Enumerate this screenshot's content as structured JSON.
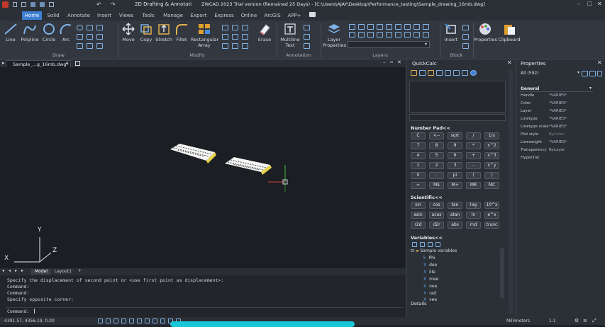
{
  "titlebar": {
    "workspace": "2D Drafting & Annotati",
    "title": "ZWCAD 2023 Trial version (Remained 25 Days) - [C:\\Users\\AJAY\\Desktop\\Performance_testing\\Sample_drawing_16mb.dwg]"
  },
  "tabs": [
    "Home",
    "Solid",
    "Annotate",
    "Insert",
    "Views",
    "Tools",
    "Manage",
    "Export",
    "Express",
    "Online",
    "ArcGIS",
    "APP+"
  ],
  "ribbon": {
    "tools": {
      "line": "Line",
      "polyline": "Polyline",
      "circle": "Circle",
      "arc": "Arc",
      "move": "Move",
      "copy": "Copy",
      "stretch": "Stretch",
      "fillet": "Fillet",
      "rect_array": "Rectangular",
      "rect_array2": "Array",
      "erase": "Erase",
      "mtext": "Multiline",
      "mtext2": "Text",
      "layer_props": "Layer",
      "layer_props2": "Properties",
      "insert": "Insert",
      "properties": "Properties",
      "clipboard": "Clipboard"
    },
    "groups": {
      "draw": "Draw",
      "modify": "Modify",
      "annotation": "Annotation",
      "layers": "Layers",
      "block": "Block"
    }
  },
  "doc_tab": "Sample_...g_16mb.dwg*",
  "layout_tabs": [
    "Model",
    "Layout1"
  ],
  "axes": {
    "x": "X",
    "y": "Y",
    "z": "Z"
  },
  "command": {
    "history": [
      "Specify the displacement of second point or <use first point as displacement>:",
      "Command:",
      "Command:",
      "Specify opposite corner:"
    ],
    "prompt": "Command:"
  },
  "status": {
    "coords": "-4391.57, 4356.19, 0.00",
    "units": "Millimeters",
    "scale": "1:1"
  },
  "quickcalc": {
    "title": "QuickCalc",
    "numberpad_label": "Number Pad<<",
    "numberpad": [
      [
        "C",
        "<--",
        "sqrt",
        "/",
        "1/x"
      ],
      [
        "7",
        "8",
        "9",
        "*",
        "x^2"
      ],
      [
        "4",
        "5",
        "6",
        "+",
        "x^3"
      ],
      [
        "1",
        "2",
        "3",
        "-",
        "x^y"
      ],
      [
        "0",
        ".",
        "pi",
        "(",
        ")"
      ],
      [
        "=",
        "MS",
        "M+",
        "MR",
        "MC"
      ]
    ],
    "scientific_label": "Scientific<<",
    "scientific": [
      [
        "sin",
        "cos",
        "tan",
        "log",
        "10^x"
      ],
      [
        "asin",
        "acos",
        "atan",
        "ln",
        "e^x"
      ],
      [
        "r2d",
        "d2r",
        "abs",
        "rnd",
        "trunc"
      ]
    ],
    "variables_label": "Variables<<",
    "variables_group": "Sample variables",
    "variables": [
      "Phi",
      "dee",
      "ille",
      "mee",
      "nee",
      "rad",
      "vee"
    ],
    "details_label": "Details"
  },
  "properties": {
    "title": "Properties",
    "selection": "All (592)",
    "section": "General",
    "rows": [
      {
        "k": "Handle",
        "v": "*VARIES*"
      },
      {
        "k": "Color",
        "v": "*VARIES*"
      },
      {
        "k": "Layer",
        "v": "*VARIES*"
      },
      {
        "k": "Linetype",
        "v": "*VARIES*"
      },
      {
        "k": "Linetype scale",
        "v": "*VARIES*"
      },
      {
        "k": "Plot style",
        "v": "ByColor"
      },
      {
        "k": "Lineweight",
        "v": "*VARIES*"
      },
      {
        "k": "Transparency",
        "v": "ByLayer"
      },
      {
        "k": "Hyperlink",
        "v": ""
      }
    ]
  }
}
